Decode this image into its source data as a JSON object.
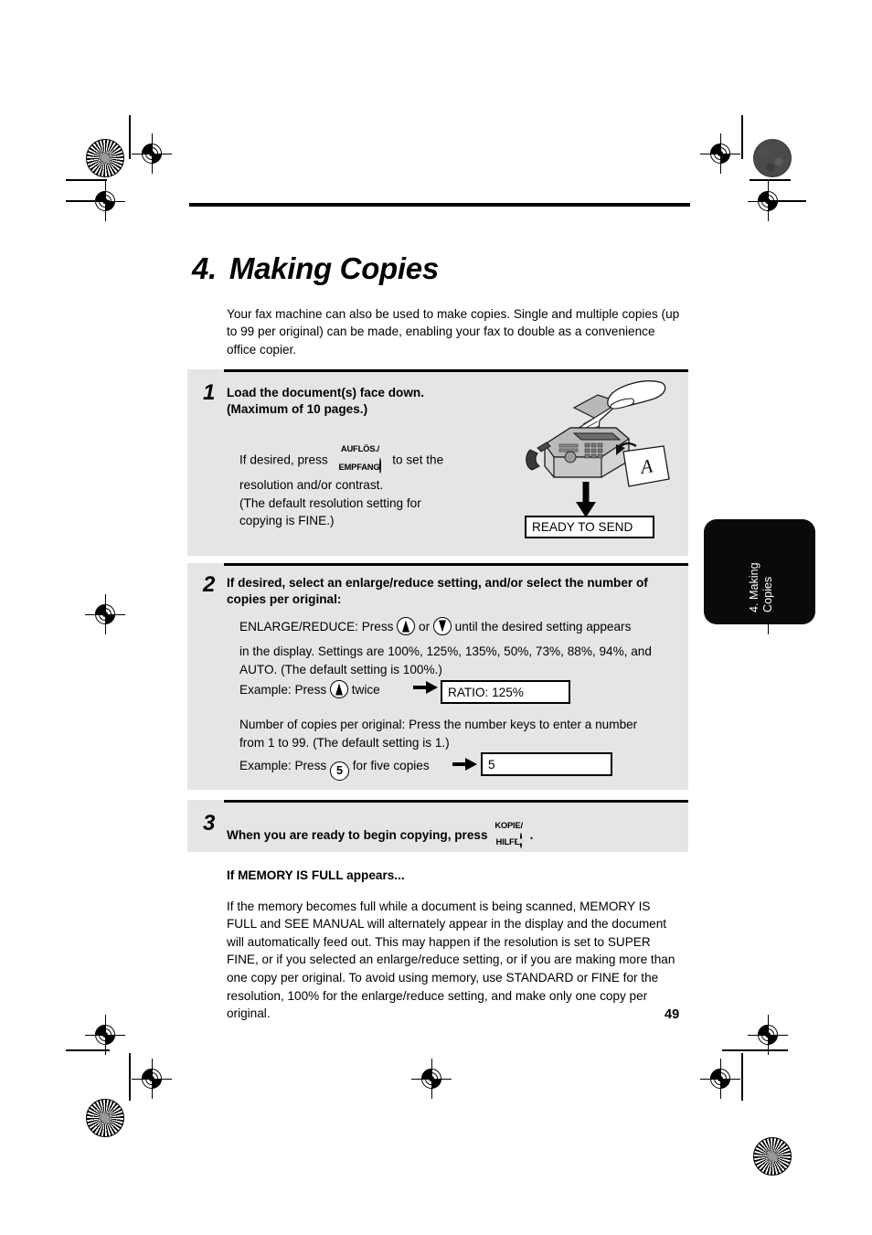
{
  "document": {
    "chapter_number": "4.",
    "chapter_title": "Making Copies",
    "page_number": "49",
    "side_tab_label": "4. Making\nCopies",
    "intro": "Your fax machine can also be used to make copies. Single and multiple copies (up to 99 per original) can be made, enabling your fax to double as a convenience office copier."
  },
  "steps": {
    "step1": {
      "number": "1",
      "heading_line1": "Load the document(s) face down.",
      "heading_line2": "(Maximum of 10 pages.)",
      "body_pre": "If desired, press",
      "button_label_line1": "AUFLÖS./",
      "button_label_line2": "EMPFANG",
      "body_post": "to set the",
      "body_line2": "resolution and/or contrast.",
      "body_line3": "(The default resolution setting for",
      "body_line4": "copying is FINE.)",
      "display_text": "READY TO SEND"
    },
    "step2": {
      "number": "2",
      "heading_line1": "If desired, select an enlarge/reduce setting, and/or select the number of",
      "heading_line2": "copies per original:",
      "er_label": "ENLARGE/REDUCE: Press",
      "er_or": "or",
      "er_tail": "until the desired setting appears",
      "er_line2": "in the display. Settings are 100%, 125%, 135%, 50%, 73%, 88%, 94%, and",
      "er_line3": "AUTO. (The default setting is 100%.)",
      "er_settings": [
        "100%",
        "125%",
        "135%",
        "50%",
        "73%",
        "88%",
        "94%",
        "AUTO"
      ],
      "er_default": "100%",
      "example1_pre": "Example: Press",
      "example1_post": "twice",
      "example1_display": "RATIO: 125%",
      "copies_line1": "Number of copies per original: Press the number keys to enter a number",
      "copies_line2": "from 1 to 99. (The default setting is 1.)",
      "example2_pre": "Example: Press",
      "example2_key": "5",
      "example2_post": "for five copies",
      "example2_display": "5"
    },
    "step3": {
      "number": "3",
      "heading_pre": "When you are ready to begin copying, press",
      "button_label_line1": "KOPIE/",
      "button_label_line2": "HILFE",
      "heading_post": "."
    }
  },
  "memory_note": {
    "heading": "If MEMORY IS FULL appears...",
    "body": "If the memory becomes full while a document is being scanned, MEMORY IS FULL and SEE MANUAL will alternately appear in the display and the document will automatically feed out. This may happen if the resolution is set to SUPER FINE, or if you selected an enlarge/reduce setting, or if you are making more than one copy per original. To avoid using memory, use STANDARD or FINE for the resolution, 100% for the enlarge/reduce setting, and make only one copy per original."
  },
  "illustration": {
    "name": "fax-machine-load-document",
    "page_letter": "A"
  },
  "colors": {
    "panel_bg": "#e5e5e5",
    "tab_bg": "#0a0a0a",
    "rule": "#000000"
  }
}
